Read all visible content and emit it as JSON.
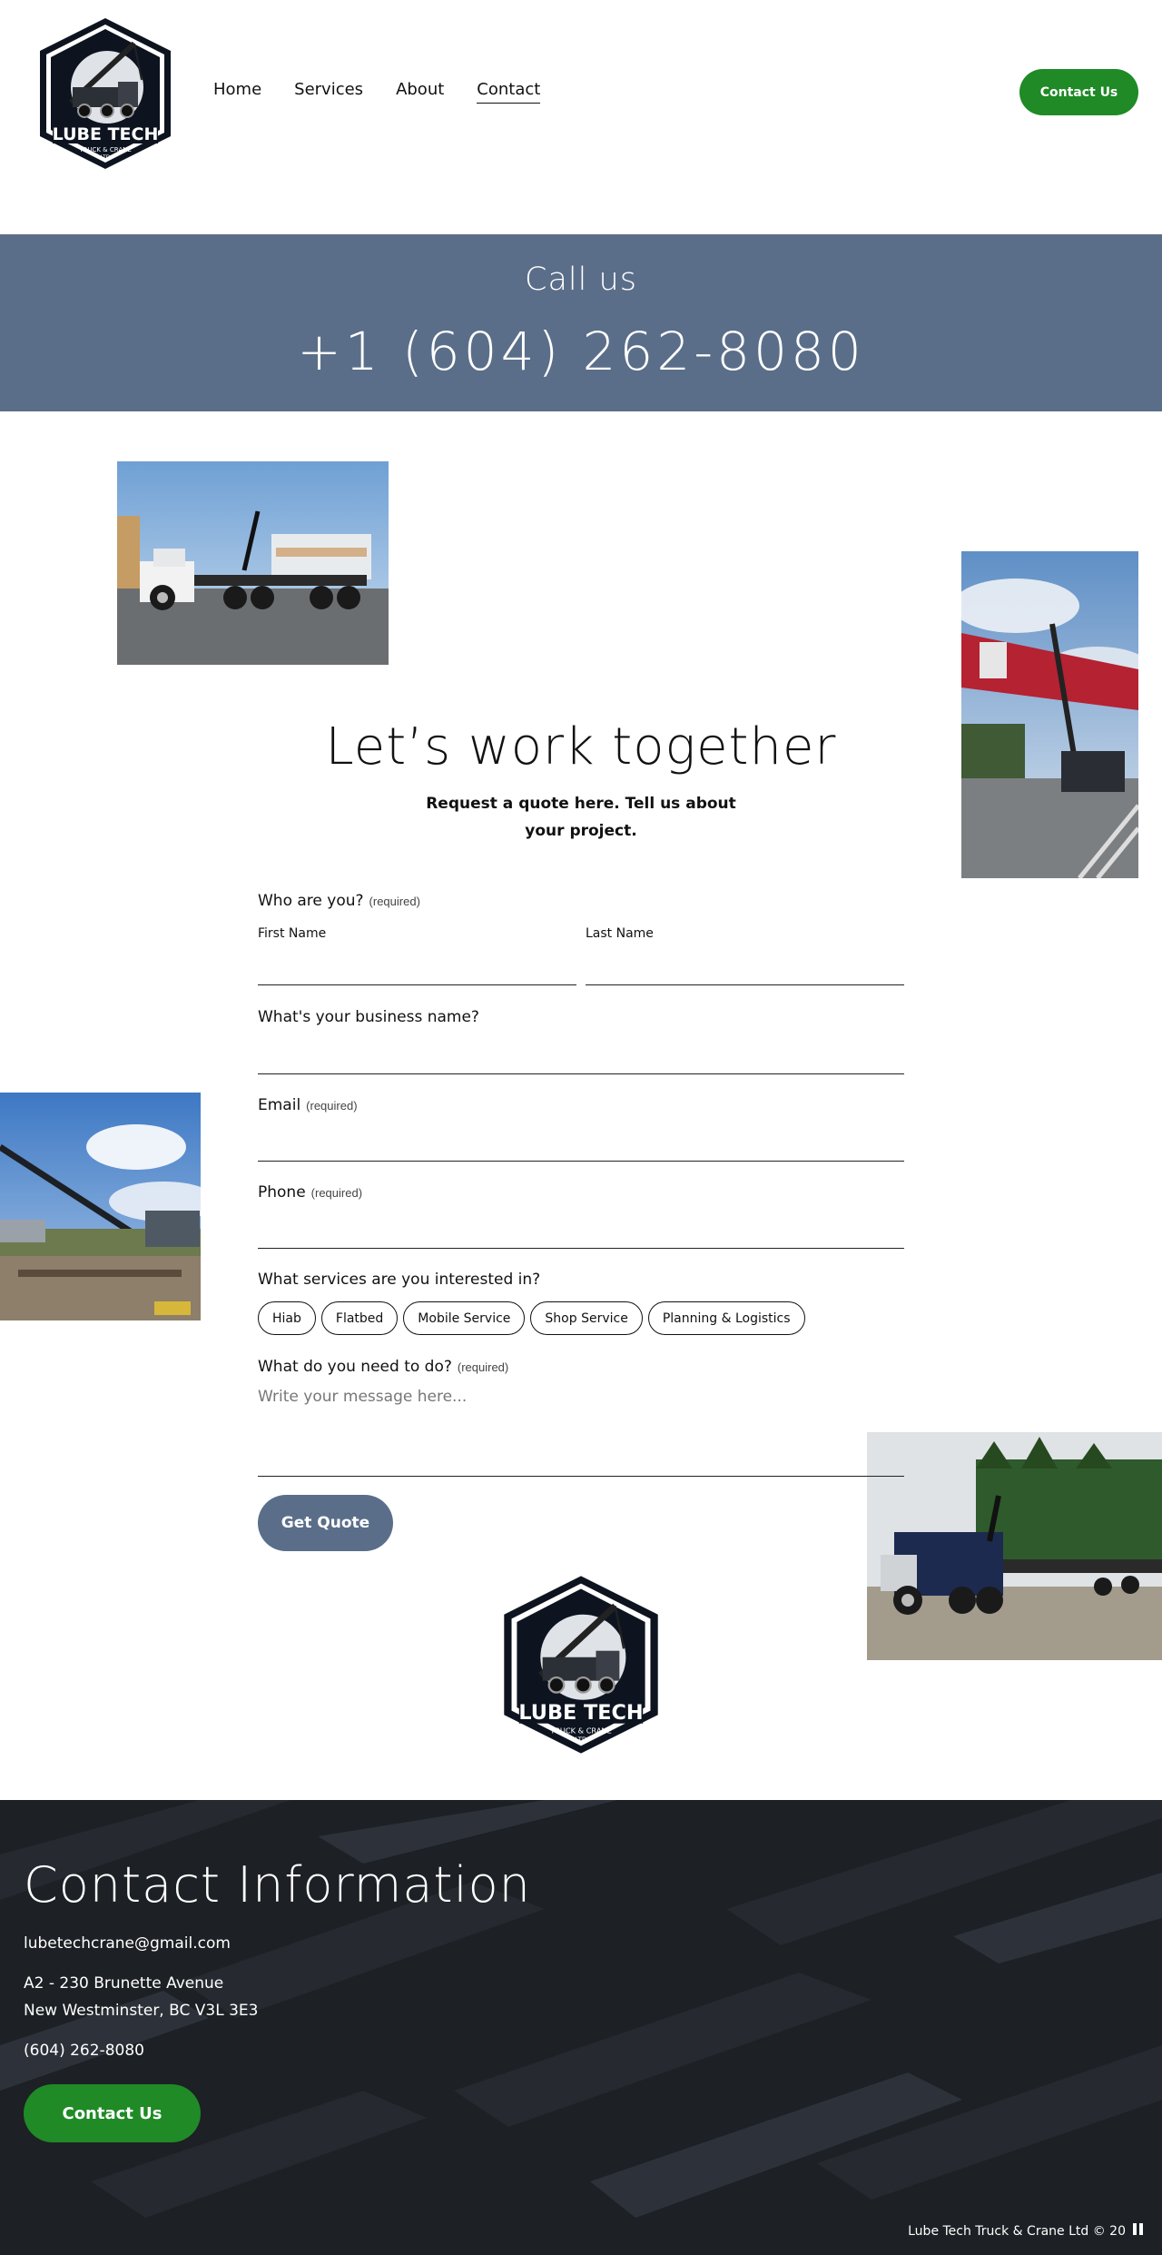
{
  "brand": {
    "name": "LUBE TECH",
    "tagline": "TRUCK & CRANE",
    "suffix": "LTD"
  },
  "nav": {
    "items": [
      "Home",
      "Services",
      "About",
      "Contact"
    ],
    "active": "Contact"
  },
  "header": {
    "cta_label": "Contact Us"
  },
  "call": {
    "title": "Call us",
    "phone": "+1 (604) 262-8080"
  },
  "main": {
    "heading": "Let’s work together",
    "subheading": "Request a quote here. Tell us about your project."
  },
  "form": {
    "who": {
      "label": "Who are you?",
      "required": "(required)",
      "first_name": "First Name",
      "last_name": "Last Name"
    },
    "business": {
      "label": "What's your business name?"
    },
    "email": {
      "label": "Email",
      "required": "(required)"
    },
    "phone": {
      "label": "Phone",
      "required": "(required)"
    },
    "services": {
      "label": "What services are you interested in?",
      "options": [
        "Hiab",
        "Flatbed",
        "Mobile Service",
        "Shop Service",
        "Planning & Logistics"
      ]
    },
    "message": {
      "label": "What do you need to do?",
      "required": "(required)",
      "placeholder": "Write your message here..."
    },
    "submit_label": "Get Quote"
  },
  "footer": {
    "title": "Contact Information",
    "email": "lubetechcrane@gmail.com",
    "address_line1": "A2 - 230 Brunette Avenue",
    "address_line2": "New Westminster, BC V3L 3E3",
    "phone": "(604) 262-8080",
    "cta_label": "Contact Us",
    "copyright": "Lube Tech Truck & Crane Ltd © 20"
  },
  "colors": {
    "accent_green": "#1f8a26",
    "slate_blue": "#5b6e89",
    "footer_bg": "#1d2024"
  },
  "icons": {
    "pause": "pause-icon"
  }
}
